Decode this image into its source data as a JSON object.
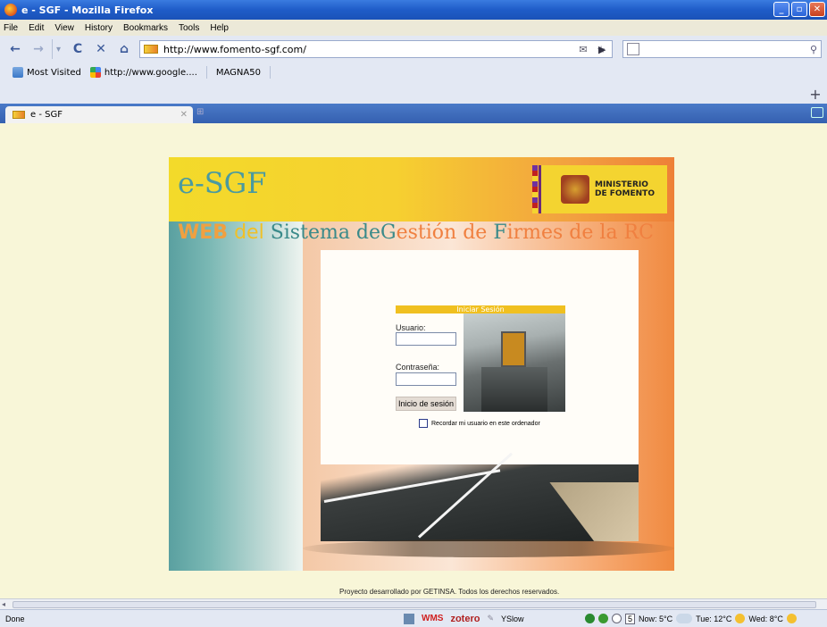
{
  "window": {
    "title": "e - SGF - Mozilla Firefox",
    "controls": [
      "_",
      "▫",
      "✕"
    ]
  },
  "menu": [
    "File",
    "Edit",
    "View",
    "History",
    "Bookmarks",
    "Tools",
    "Help"
  ],
  "nav": {
    "url": "http://www.fomento-sgf.com/",
    "search_placeholder": ""
  },
  "bookmarks": {
    "items": [
      "Most Visited",
      "http://www.google....",
      "MAGNA50"
    ]
  },
  "tabs": {
    "active_label": "e - SGF"
  },
  "page": {
    "logo": "e-SGF",
    "ministry": [
      "MINISTERIO",
      "DE FOMENTO"
    ],
    "subtitle_parts": [
      "WEB",
      "del",
      "Sistema de",
      "G",
      "estión de",
      "F",
      "irmes de la RC"
    ],
    "login": {
      "header": "Iniciar Sesión",
      "user_label": "Usuario:",
      "password_label": "Contraseña:",
      "submit_label": "Inicio de sesión",
      "remember_label": "Recordar mi usuario en este ordenador",
      "user_value": "",
      "password_value": ""
    },
    "footer": "Proyecto desarrollado por GETINSA. Todos los derechos reservados."
  },
  "status": {
    "text": "Done",
    "addons": [
      "WMS",
      "zotero",
      "YSlow"
    ],
    "weather": {
      "day_counter": "5",
      "now": "Now: 5°C",
      "tue": "Tue: 12°C",
      "wed": "Wed: 8°C"
    }
  }
}
